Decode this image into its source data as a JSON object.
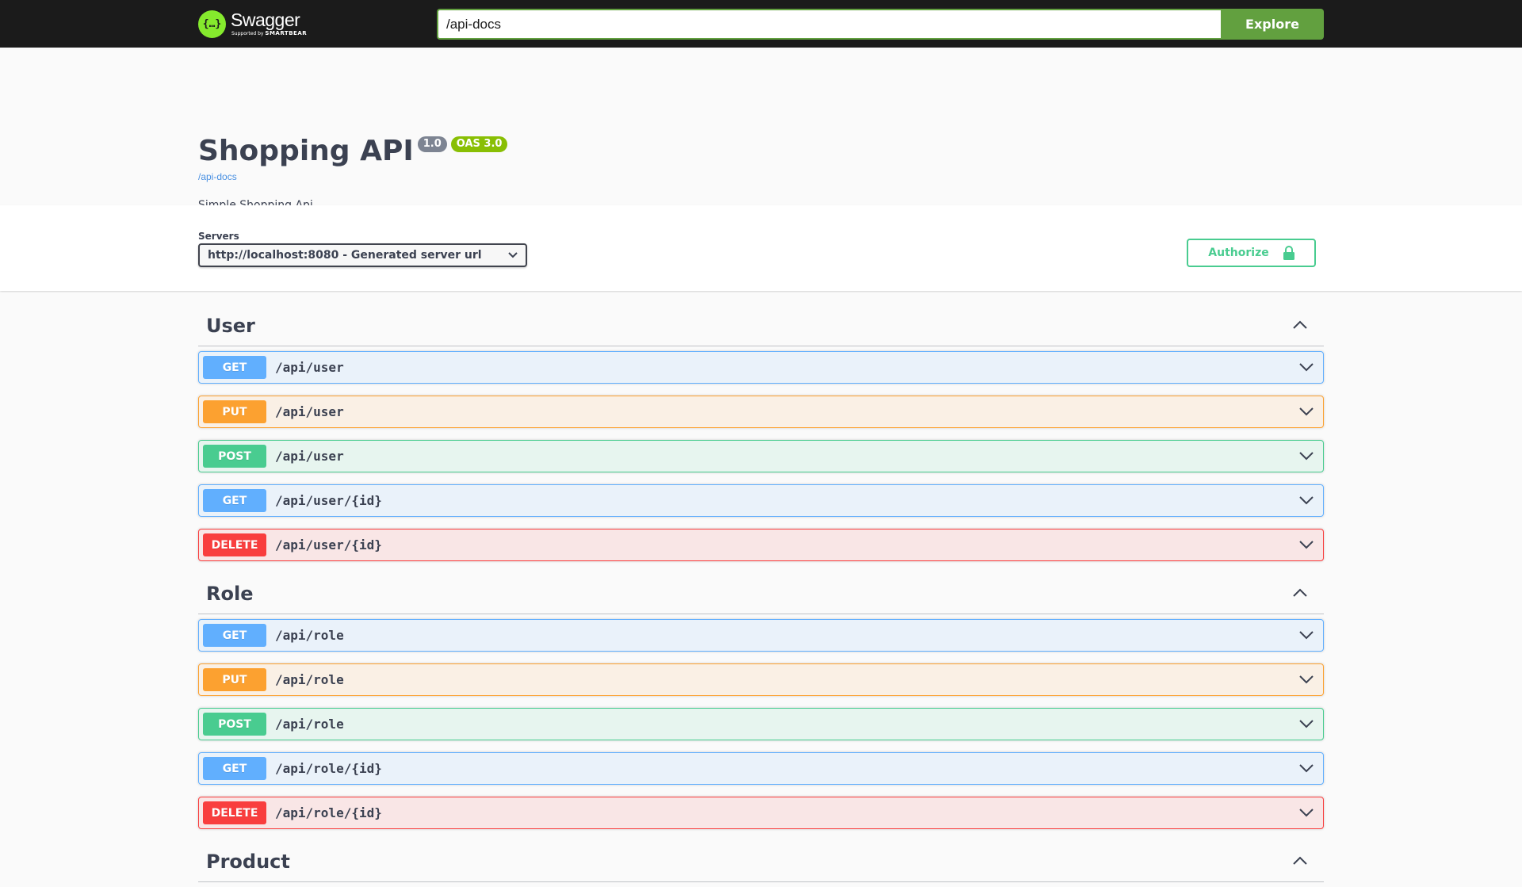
{
  "topbar": {
    "logo_text": "Swagger",
    "logo_sub_prefix": "Supported by",
    "logo_sub_brand": "SMARTBEAR",
    "url_value": "/api-docs",
    "explore_label": "Explore"
  },
  "info": {
    "title": "Shopping API",
    "version": "1.0",
    "oas": "OAS 3.0",
    "link": "/api-docs",
    "description": "Simple Shopping Api"
  },
  "servers": {
    "label": "Servers",
    "selected": "http://localhost:8080 - Generated server url",
    "authorize_label": "Authorize"
  },
  "colors": {
    "get": "#61affe",
    "put": "#fca130",
    "post": "#49cc90",
    "delete": "#f93e3e",
    "topbar": "#1b1b1b",
    "explore": "#62a03f"
  },
  "tags": [
    {
      "name": "User",
      "operations": [
        {
          "method": "GET",
          "path": "/api/user"
        },
        {
          "method": "PUT",
          "path": "/api/user"
        },
        {
          "method": "POST",
          "path": "/api/user"
        },
        {
          "method": "GET",
          "path": "/api/user/{id}"
        },
        {
          "method": "DELETE",
          "path": "/api/user/{id}"
        }
      ]
    },
    {
      "name": "Role",
      "operations": [
        {
          "method": "GET",
          "path": "/api/role"
        },
        {
          "method": "PUT",
          "path": "/api/role"
        },
        {
          "method": "POST",
          "path": "/api/role"
        },
        {
          "method": "GET",
          "path": "/api/role/{id}"
        },
        {
          "method": "DELETE",
          "path": "/api/role/{id}"
        }
      ]
    },
    {
      "name": "Product",
      "operations": []
    }
  ]
}
